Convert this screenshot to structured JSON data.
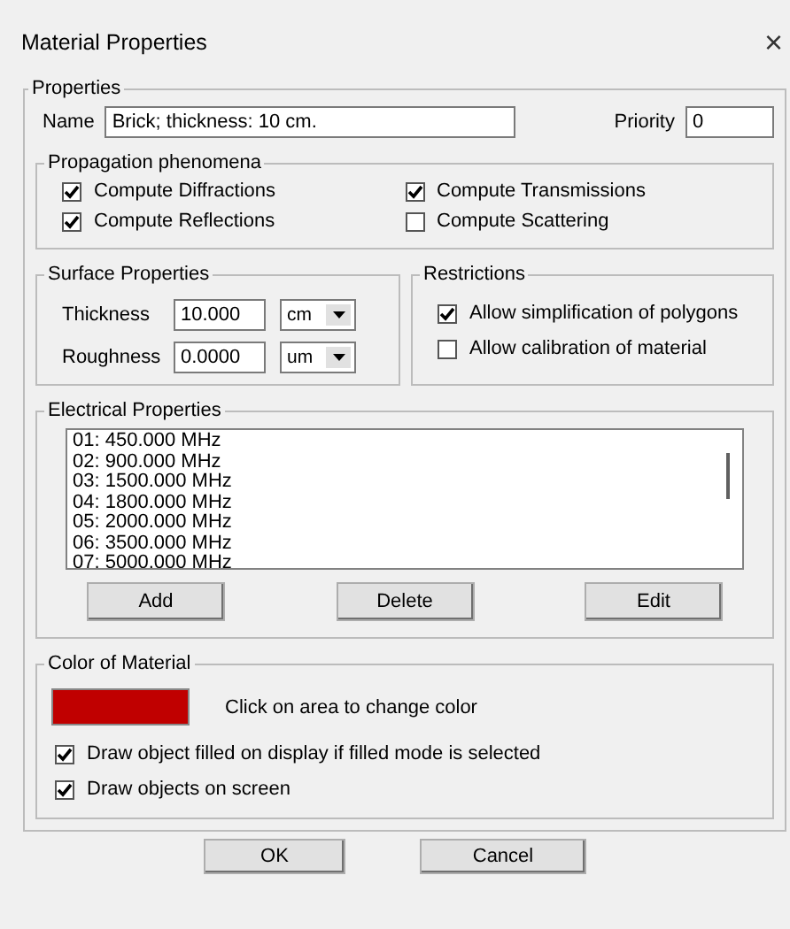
{
  "window": {
    "title": "Material Properties",
    "close": "×"
  },
  "properties": {
    "title": "Properties",
    "name_label": "Name",
    "name_value": "Brick; thickness: 10 cm.",
    "priority_label": "Priority",
    "priority_value": "0"
  },
  "propagation": {
    "title": "Propagation phenomena",
    "options": [
      {
        "label": "Compute Diffractions",
        "checked": true
      },
      {
        "label": "Compute Transmissions",
        "checked": true
      },
      {
        "label": "Compute Reflections",
        "checked": true
      },
      {
        "label": "Compute Scattering",
        "checked": false
      }
    ]
  },
  "surface": {
    "title": "Surface Properties",
    "rows": [
      {
        "label": "Thickness",
        "value": "10.000",
        "unit": "cm"
      },
      {
        "label": "Roughness",
        "value": "0.0000",
        "unit": "um"
      }
    ]
  },
  "restrictions": {
    "title": "Restrictions",
    "options": [
      {
        "label": "Allow simplification of polygons",
        "checked": true
      },
      {
        "label": "Allow calibration of material",
        "checked": false
      }
    ]
  },
  "electrical": {
    "title": "Electrical Properties",
    "items": [
      "01: 450.000 MHz",
      "02: 900.000 MHz",
      "03: 1500.000 MHz",
      "04: 1800.000 MHz",
      "05: 2000.000 MHz",
      "06: 3500.000 MHz",
      "07: 5000.000 MHz"
    ],
    "buttons": [
      "Add",
      "Delete",
      "Edit"
    ]
  },
  "color_of_material": {
    "title": "Color of Material",
    "color": "#c00000",
    "hint": "Click on area to change color",
    "options": [
      {
        "label": "Draw object filled on display if filled mode is selected",
        "checked": true
      },
      {
        "label": "Draw objects on screen",
        "checked": true
      }
    ]
  },
  "buttons": [
    "OK",
    "Cancel"
  ]
}
